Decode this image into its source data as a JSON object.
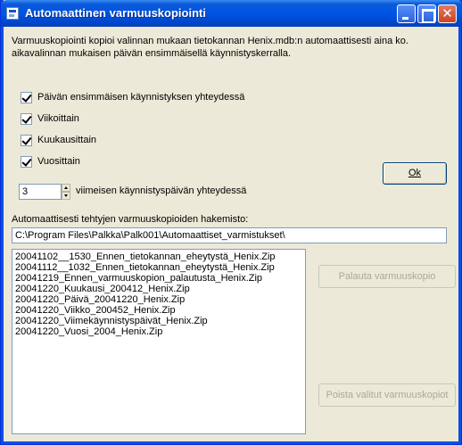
{
  "window": {
    "title": "Automaattinen varmuuskopiointi",
    "close_glyph": "✕"
  },
  "description": {
    "line1": "Varmuuskopiointi kopioi valinnan mukaan tietokannan Henix.mdb:n automaattisesti aina ko.",
    "line2": "aikavalinnan mukaisen päivän ensimmäisellä käynnistyskerralla."
  },
  "options": [
    {
      "label": "Päivän ensimmäisen käynnistyksen yhteydessä",
      "checked": true
    },
    {
      "label": "Viikoittain",
      "checked": true
    },
    {
      "label": "Kuukausittain",
      "checked": true
    },
    {
      "label": "Vuosittain",
      "checked": true
    }
  ],
  "spinner": {
    "value": "3",
    "label": "viimeisen käynnistyspäivän yhteydessä"
  },
  "ok_button": "Ok",
  "path": {
    "label": "Automaattisesti tehtyjen varmuuskopioiden hakemisto:",
    "value": "C:\\Program Files\\Palkka\\Palk001\\Automaattiset_varmistukset\\"
  },
  "backups": [
    "20041102__1530_Ennen_tietokannan_eheytystä_Henix.Zip",
    "20041112__1032_Ennen_tietokannan_eheytystä_Henix.Zip",
    "20041219_Ennen_varmuuskopion_palautusta_Henix.Zip",
    "20041220_Kuukausi_200412_Henix.Zip",
    "20041220_Päivä_20041220_Henix.Zip",
    "20041220_Viikko_200452_Henix.Zip",
    "20041220_Viimekäynnistyspäivät_Henix.Zip",
    "20041220_Vuosi_2004_Henix.Zip"
  ],
  "restore_button": "Palauta varmuuskopio",
  "delete_button": "Poista valitut varmuuskopiot"
}
